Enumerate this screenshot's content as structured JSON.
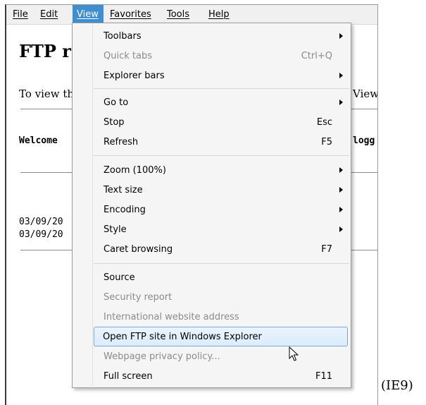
{
  "menubar": {
    "items": [
      {
        "label": "File"
      },
      {
        "label": "Edit"
      },
      {
        "label": "View"
      },
      {
        "label": "Favorites"
      },
      {
        "label": "Tools"
      },
      {
        "label": "Help"
      }
    ],
    "active": "View"
  },
  "page": {
    "title": "FTP r",
    "intro": "To view th",
    "intro_right": "View,",
    "welcome": "Welcome",
    "welcome_right": "logg",
    "listing": [
      "03/09/20",
      "03/09/20"
    ]
  },
  "view_menu": {
    "items": [
      {
        "label": "Toolbars",
        "submenu": true
      },
      {
        "label": "Quick tabs",
        "shortcut": "Ctrl+Q",
        "disabled": true
      },
      {
        "label": "Explorer bars",
        "submenu": true
      },
      {
        "label": "Go to",
        "submenu": true
      },
      {
        "label": "Stop",
        "shortcut": "Esc"
      },
      {
        "label": "Refresh",
        "shortcut": "F5"
      },
      {
        "label": "Zoom (100%)",
        "submenu": true
      },
      {
        "label": "Text size",
        "submenu": true
      },
      {
        "label": "Encoding",
        "submenu": true
      },
      {
        "label": "Style",
        "submenu": true
      },
      {
        "label": "Caret browsing",
        "shortcut": "F7"
      },
      {
        "label": "Source"
      },
      {
        "label": "Security report",
        "disabled": true
      },
      {
        "label": "International website address",
        "disabled": true
      },
      {
        "label": "Open FTP site in Windows Explorer",
        "highlighted": true
      },
      {
        "label": "Webpage privacy policy...",
        "disabled": true
      },
      {
        "label": "Full screen",
        "shortcut": "F11"
      }
    ]
  },
  "caption": "(IE9)",
  "colors": {
    "menubar_active": "#3f8fd0",
    "menu_highlight_border": "#7aa7da",
    "disabled_text": "#8a8a8a"
  },
  "icons": {
    "cursor": "mouse-pointer-icon",
    "submenu": "chevron-right-icon"
  }
}
